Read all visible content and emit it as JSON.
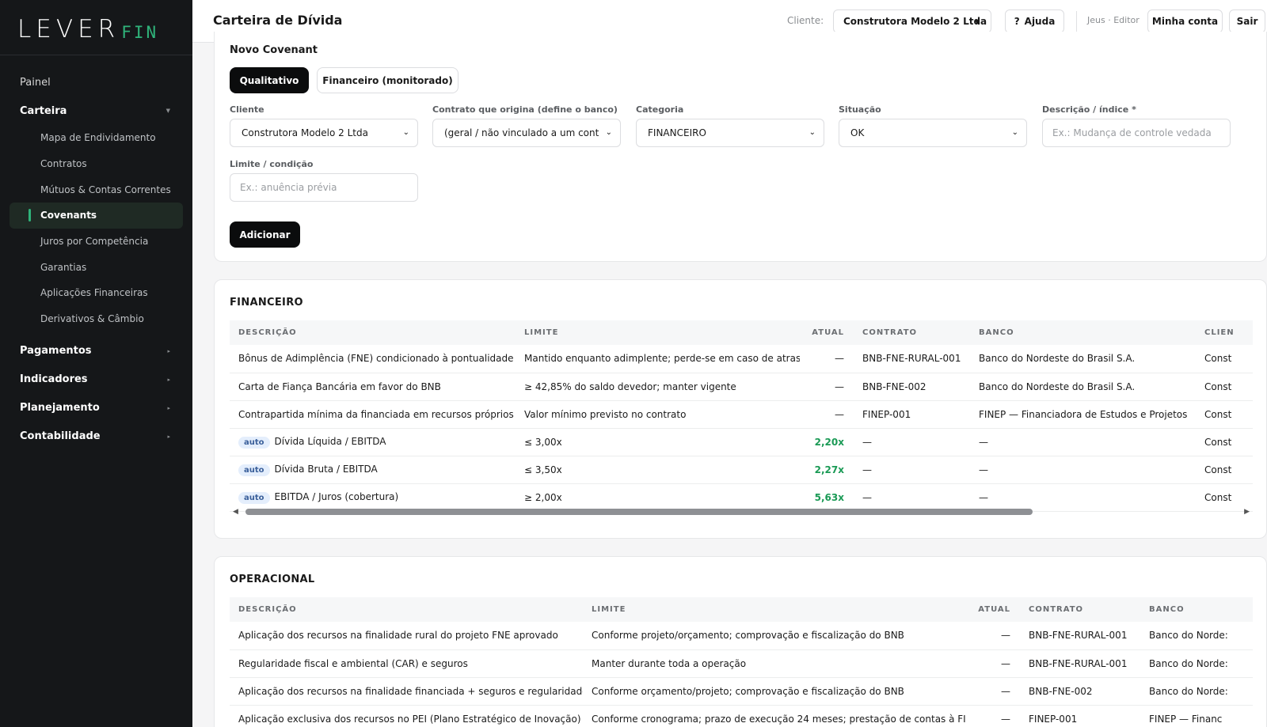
{
  "sidebar": {
    "logo_main": "LEVER",
    "logo_accent": "FIN",
    "items": [
      {
        "label": "Painel"
      },
      {
        "label": "Carteira"
      },
      {
        "label": "Pagamentos"
      },
      {
        "label": "Indicadores"
      },
      {
        "label": "Planejamento"
      },
      {
        "label": "Contabilidade"
      }
    ],
    "carteira_sub": [
      {
        "label": "Mapa de Endividamento"
      },
      {
        "label": "Contratos"
      },
      {
        "label": "Mútuos & Contas Correntes"
      },
      {
        "label": "Covenants"
      },
      {
        "label": "Juros por Competência"
      },
      {
        "label": "Garantias"
      },
      {
        "label": "Aplicações Financeiras"
      },
      {
        "label": "Derivativos & Câmbio"
      }
    ]
  },
  "header": {
    "title": "Carteira de Dívida",
    "client_label": "Cliente:",
    "client_value": "Construtora Modelo 2 Ltda",
    "help_icon": "?",
    "help_label": "Ajuda",
    "user_label": "Jeus · Editor",
    "account_label": "Minha conta",
    "logout_label": "Sair"
  },
  "form": {
    "title": "Novo Covenant",
    "tabs": [
      {
        "label": "Qualitativo",
        "active": true
      },
      {
        "label": "Financeiro (monitorado)",
        "active": false
      }
    ],
    "fields": {
      "cliente": {
        "label": "Cliente",
        "value": "Construtora Modelo 2 Ltda"
      },
      "contrato": {
        "label": "Contrato que origina (define o banco)",
        "value": "(geral / não vinculado a um cont"
      },
      "categoria": {
        "label": "Categoria",
        "value": "FINANCEIRO"
      },
      "situacao": {
        "label": "Situação",
        "value": "OK"
      },
      "descricao": {
        "label": "Descrição / índice *",
        "placeholder": "Ex.: Mudança de controle vedada"
      },
      "limite": {
        "label": "Limite / condição",
        "placeholder": "Ex.: anuência prévia"
      }
    },
    "submit_label": "Adicionar"
  },
  "financeiro": {
    "title": "FINANCEIRO",
    "columns": [
      "DESCRIÇÃO",
      "LIMITE",
      "ATUAL",
      "CONTRATO",
      "BANCO",
      "CLIEN"
    ],
    "rows": [
      {
        "badge": "",
        "descricao": "Bônus de Adimplência (FNE) condicionado à pontualidade",
        "limite": "Mantido enquanto adimplente; perde-se em caso de atraso",
        "atual": "—",
        "contrato": "BNB-FNE-RURAL-001",
        "banco": "Banco do Nordeste do Brasil S.A.",
        "cliente": "Const"
      },
      {
        "badge": "",
        "descricao": "Carta de Fiança Bancária em favor do BNB",
        "limite": "≥ 42,85% do saldo devedor; manter vigente",
        "atual": "—",
        "contrato": "BNB-FNE-002",
        "banco": "Banco do Nordeste do Brasil S.A.",
        "cliente": "Const"
      },
      {
        "badge": "",
        "descricao": "Contrapartida mínima da financiada em recursos próprios",
        "limite": "Valor mínimo previsto no contrato",
        "atual": "—",
        "contrato": "FINEP-001",
        "banco": "FINEP — Financiadora de Estudos e Projetos",
        "cliente": "Const"
      },
      {
        "badge": "auto",
        "descricao": "Dívida Líquida / EBITDA",
        "limite": "≤ 3,00x",
        "atual": "2,20x",
        "contrato": "—",
        "banco": "—",
        "cliente": "Const"
      },
      {
        "badge": "auto",
        "descricao": "Dívida Bruta / EBITDA",
        "limite": "≤ 3,50x",
        "atual": "2,27x",
        "contrato": "—",
        "banco": "—",
        "cliente": "Const"
      },
      {
        "badge": "auto",
        "descricao": "EBITDA / Juros (cobertura)",
        "limite": "≥ 2,00x",
        "atual": "5,63x",
        "contrato": "—",
        "banco": "—",
        "cliente": "Const"
      }
    ]
  },
  "operacional": {
    "title": "OPERACIONAL",
    "columns": [
      "DESCRIÇÃO",
      "LIMITE",
      "ATUAL",
      "CONTRATO",
      "BANCO"
    ],
    "rows": [
      {
        "descricao": "Aplicação dos recursos na finalidade rural do projeto FNE aprovado",
        "limite": "Conforme projeto/orçamento; comprovação e fiscalização do BNB",
        "atual": "—",
        "contrato": "BNB-FNE-RURAL-001",
        "banco": "Banco do Norde:"
      },
      {
        "descricao": "Regularidade fiscal e ambiental (CAR) e seguros",
        "limite": "Manter durante toda a operação",
        "atual": "—",
        "contrato": "BNB-FNE-RURAL-001",
        "banco": "Banco do Norde:"
      },
      {
        "descricao": "Aplicação dos recursos na finalidade financiada + seguros e regularidade",
        "limite": "Conforme orçamento/projeto; comprovação e fiscalização do BNB",
        "atual": "—",
        "contrato": "BNB-FNE-002",
        "banco": "Banco do Norde:"
      },
      {
        "descricao": "Aplicação exclusiva dos recursos no PEI (Plano Estratégico de Inovação)",
        "limite": "Conforme cronograma; prazo de execução 24 meses; prestação de contas à FINEP",
        "atual": "—",
        "contrato": "FINEP-001",
        "banco": "FINEP — Financ"
      }
    ]
  },
  "colors": {
    "sidebar_bg": "#151719",
    "accent_green": "#2fb37a",
    "value_green": "#1a9a55",
    "primary_button": "#0b0c0d",
    "badge_bg": "#e4eefc"
  },
  "icons": {
    "nav_chevron": "chevron-down-icon",
    "select_caret": "chevron-down-icon",
    "help": "question-icon",
    "scroll_left": "triangle-left-icon",
    "scroll_right": "triangle-right-icon"
  }
}
